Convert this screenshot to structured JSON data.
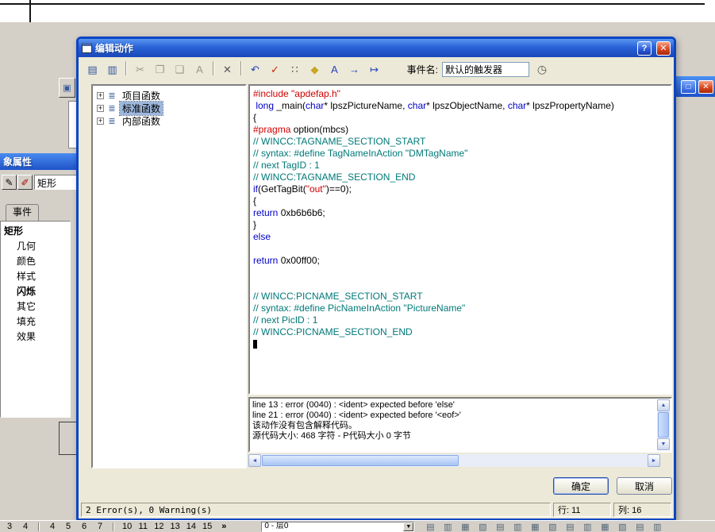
{
  "glyphs": {
    "up": "▲",
    "down": "▼",
    "left": "◄",
    "right": "►",
    "dropdown": "▼",
    "plus": "+",
    "pen1": "✎",
    "pen2": "✐",
    "mini_btn": "▣"
  },
  "colors": {
    "titlebar_blue": "#2a63d8",
    "dialog_bg": "#ece9d8",
    "selection": "#9db7dd",
    "code_comment": "#007878",
    "code_keyword": "#0000c8",
    "code_string": "#d00000"
  },
  "dialog": {
    "title": "编辑动作",
    "titlebar": {
      "help": "?",
      "close": "✕"
    },
    "toolbar": {
      "icons": [
        {
          "name": "action-attach-icon",
          "glyph": "▤",
          "color": "#33569c"
        },
        {
          "name": "action-info-icon",
          "glyph": "▥",
          "color": "#33569c"
        },
        {
          "divider": true
        },
        {
          "name": "cut-icon",
          "glyph": "✂",
          "color": "#9a968a",
          "disabled": true
        },
        {
          "name": "copy-icon",
          "glyph": "❐",
          "color": "#9a968a",
          "disabled": true
        },
        {
          "name": "paste-icon",
          "glyph": "❑",
          "color": "#9a968a",
          "disabled": true
        },
        {
          "name": "replace-icon",
          "glyph": "A",
          "color": "#9a968a",
          "disabled": true
        },
        {
          "divider": true
        },
        {
          "name": "delete-icon",
          "glyph": "✕",
          "color": "#555555"
        },
        {
          "divider": true
        },
        {
          "name": "undo-icon",
          "glyph": "↶",
          "color": "#2244bb"
        },
        {
          "name": "check-syntax-icon",
          "glyph": "✓",
          "color": "#cc2200"
        },
        {
          "name": "tag-dialog-icon",
          "glyph": "∷",
          "color": "#444444"
        },
        {
          "name": "object-cube-icon",
          "glyph": "◆",
          "color": "#c8a620"
        },
        {
          "name": "font-icon",
          "glyph": "A",
          "color": "#2244bb"
        },
        {
          "name": "import-action-icon",
          "glyph": "→",
          "color": "#2244bb"
        },
        {
          "name": "export-action-icon",
          "glyph": "↦",
          "color": "#2244bb"
        }
      ],
      "event_label": "事件名:",
      "event_value": "默认的触发器",
      "trigger_icon": "◷"
    },
    "tree": {
      "icon": "≣",
      "items": [
        {
          "label": "项目函数"
        },
        {
          "label": "标准函数",
          "selected": true
        },
        {
          "label": "内部函数"
        }
      ]
    },
    "code": {
      "lines": [
        [
          [
            "pp",
            "#include \"apdefap.h\""
          ]
        ],
        [
          [
            "pl",
            " "
          ],
          [
            "kw",
            "long"
          ],
          [
            "pl",
            " _main("
          ],
          [
            "kw",
            "char"
          ],
          [
            "pl",
            "* lpszPictureName, "
          ],
          [
            "kw",
            "char"
          ],
          [
            "pl",
            "* lpszObjectName, "
          ],
          [
            "kw",
            "char"
          ],
          [
            "pl",
            "* lpszPropertyName)"
          ]
        ],
        [
          [
            "pl",
            "{"
          ]
        ],
        [
          [
            "pp",
            "#pragma"
          ],
          [
            "pl",
            " option(mbcs)"
          ]
        ],
        [
          [
            "cm",
            "// WINCC:TAGNAME_SECTION_START"
          ]
        ],
        [
          [
            "cm",
            "// syntax: #define TagNameInAction \"DMTagName\""
          ]
        ],
        [
          [
            "cm",
            "// next TagID : 1"
          ]
        ],
        [
          [
            "cm",
            "// WINCC:TAGNAME_SECTION_END"
          ]
        ],
        [
          [
            "kw",
            "if"
          ],
          [
            "pl",
            "(GetTagBit("
          ],
          [
            "str",
            "\"out\""
          ],
          [
            "pl",
            ")==0);"
          ]
        ],
        [
          [
            "pl",
            "{"
          ]
        ],
        [
          [
            "kw",
            "return"
          ],
          [
            "pl",
            " 0xb6b6b6;"
          ]
        ],
        [
          [
            "pl",
            "}"
          ]
        ],
        [
          [
            "kw",
            "else"
          ]
        ],
        [],
        [
          [
            "kw",
            "return"
          ],
          [
            "pl",
            " 0x00ff00;"
          ]
        ],
        [],
        [],
        [
          [
            "cm",
            "// WINCC:PICNAME_SECTION_START"
          ]
        ],
        [
          [
            "cm",
            "// syntax: #define PicNameInAction \"PictureName\""
          ]
        ],
        [
          [
            "cm",
            "// next PicID : 1"
          ]
        ],
        [
          [
            "cm",
            "// WINCC:PICNAME_SECTION_END"
          ]
        ],
        [
          [
            "cur",
            ""
          ]
        ]
      ]
    },
    "errors": {
      "lines": [
        "line 13 : error (0040) : <ident> expected before 'else'",
        "line 21 : error (0040) : <ident> expected before '<eof>'",
        "该动作没有包含解释代码。",
        "源代码大小: 468 字符 - P代码大小 0 字节"
      ]
    },
    "buttons": {
      "ok": "确定",
      "cancel": "取消"
    },
    "status": {
      "message": "2 Error(s), 0 Warning(s)",
      "line": "行: 11",
      "column": "列: 16"
    }
  },
  "background": {
    "props_window": {
      "title": "象属性",
      "combo_value": "矩形",
      "tab": "事件",
      "object": "矩形",
      "categories": [
        {
          "label": "几何"
        },
        {
          "label": "颜色"
        },
        {
          "label": "样式"
        },
        {
          "label": "闪烁",
          "bold": true
        },
        {
          "label": "其它"
        },
        {
          "label": "填充"
        },
        {
          "label": "效果"
        }
      ]
    },
    "background_window": {
      "maximize": "□",
      "close": "✕"
    },
    "layer_bar": {
      "items": [
        "3",
        "4",
        "|",
        "4",
        "5",
        "6",
        "7",
        "|",
        "10",
        "11",
        "12",
        "13",
        "14",
        "15"
      ],
      "overflow": "»",
      "layer_combo": "0 - 层0",
      "icons": [
        "▤",
        "▥",
        "▦",
        "▧",
        "▤",
        "▥",
        "▦",
        "▧",
        "▤",
        "▥",
        "▦",
        "▧",
        "▤",
        "▥"
      ]
    }
  }
}
